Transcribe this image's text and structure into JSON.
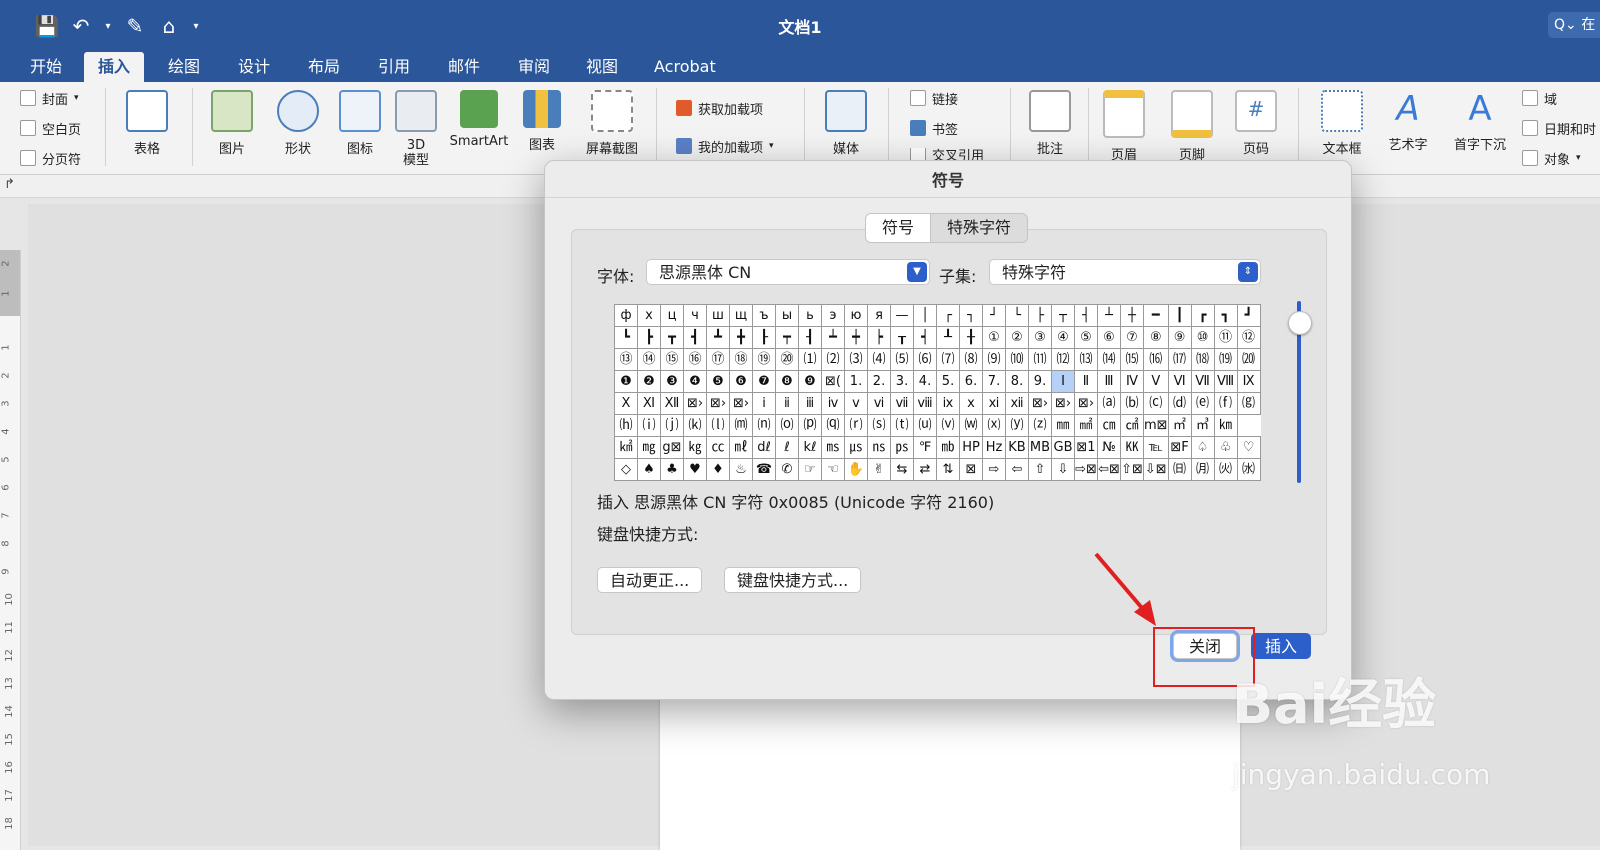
{
  "title_bar": {
    "doc_title": "文档1",
    "search_text": "Q⌄ 在"
  },
  "ribbon_tabs": [
    "开始",
    "插入",
    "绘图",
    "设计",
    "布局",
    "引用",
    "邮件",
    "审阅",
    "视图",
    "Acrobat"
  ],
  "active_tab": "插入",
  "ribbon": {
    "pages": {
      "cover": "封面",
      "blank": "空白页",
      "pagebreak": "分页符"
    },
    "table": "表格",
    "picture": "图片",
    "shapes": "形状",
    "icons": "图标",
    "model3d": "3D\n模型",
    "smartart": "SmartArt",
    "chart": "图表",
    "screenshot": "屏幕截图",
    "get_addins": "获取加载项",
    "my_addins": "我的加载项",
    "media": "媒体",
    "link": "链接",
    "bookmark": "书签",
    "crossref": "交叉引用",
    "comment": "批注",
    "header": "页眉",
    "footer": "页脚",
    "page_number": "页码",
    "textbox": "文本框",
    "wordart": "艺术字",
    "dropcap": "首字下沉",
    "field": "域",
    "datetime": "日期和时",
    "object": "对象"
  },
  "ruler_numbers": [
    "2",
    "1",
    "1",
    "2",
    "3",
    "4",
    "5",
    "6",
    "7",
    "8",
    "9",
    "10",
    "11",
    "12",
    "13",
    "14",
    "15",
    "16",
    "17",
    "18"
  ],
  "dialog": {
    "title": "符号",
    "tabs": [
      "符号",
      "特殊字符"
    ],
    "active_tab": "符号",
    "font_label": "字体:",
    "font_value": "思源黑体 CN",
    "subset_label": "子集:",
    "subset_value": "特殊字符",
    "symbols": [
      [
        "ф",
        "х",
        "ц",
        "ч",
        "ш",
        "щ",
        "ъ",
        "ы",
        "ь",
        "э",
        "ю",
        "я",
        "—",
        "│",
        "┌",
        "┐",
        "┘",
        "└",
        "├",
        "┬",
        "┤",
        "┴",
        "┼",
        "━",
        "┃",
        "┏",
        "┓",
        "┛"
      ],
      [
        "┗",
        "┣",
        "┳",
        "┫",
        "┻",
        "╋",
        "┠",
        "┯",
        "┨",
        "┷",
        "┿",
        "┝",
        "┰",
        "┥",
        "┸",
        "╂",
        "①",
        "②",
        "③",
        "④",
        "⑤",
        "⑥",
        "⑦",
        "⑧",
        "⑨",
        "⑩",
        "⑪",
        "⑫"
      ],
      [
        "⑬",
        "⑭",
        "⑮",
        "⑯",
        "⑰",
        "⑱",
        "⑲",
        "⑳",
        "⑴",
        "⑵",
        "⑶",
        "⑷",
        "⑸",
        "⑹",
        "⑺",
        "⑻",
        "⑼",
        "⑽",
        "⑾",
        "⑿",
        "⒀",
        "⒁",
        "⒂",
        "⒃",
        "⒄",
        "⒅",
        "⒆",
        "⒇"
      ],
      [
        "❶",
        "❷",
        "❸",
        "❹",
        "❺",
        "❻",
        "❼",
        "❽",
        "❾",
        "⊠(",
        "1.",
        "2.",
        "3.",
        "4.",
        "5.",
        "6.",
        "7.",
        "8.",
        "9.",
        "Ⅰ",
        "Ⅱ",
        "Ⅲ",
        "Ⅳ",
        "Ⅴ",
        "Ⅵ",
        "Ⅶ",
        "Ⅷ",
        "Ⅸ"
      ],
      [
        "Ⅹ",
        "Ⅺ",
        "Ⅻ",
        "⊠›",
        "⊠›",
        "⊠›",
        "ⅰ",
        "ⅱ",
        "ⅲ",
        "ⅳ",
        "ⅴ",
        "ⅵ",
        "ⅶ",
        "ⅷ",
        "ⅸ",
        "ⅹ",
        "ⅺ",
        "ⅻ",
        "⊠›",
        "⊠›",
        "⊠›",
        "⒜",
        "⒝",
        "⒞",
        "⒟",
        "⒠",
        "⒡",
        "⒢"
      ],
      [
        "⒣",
        "⒤",
        "⒥",
        "⒦",
        "⒧",
        "⒨",
        "⒩",
        "⒪",
        "⒫",
        "⒬",
        "⒭",
        "⒮",
        "⒯",
        "⒰",
        "⒱",
        "⒲",
        "⒳",
        "⒴",
        "⒵",
        "㎜",
        "㎟",
        "㎝",
        "㎠",
        "m⊠",
        "㎡",
        "㎥",
        "㎞"
      ],
      [
        "㎢",
        "㎎",
        "g⊠",
        "㎏",
        "㏄",
        "㎖",
        "dℓ",
        "ℓ",
        "kℓ",
        "㎳",
        "㎲",
        "㎱",
        "㎰",
        "℉",
        "㏔",
        "HP",
        "Hz",
        "KB",
        "MB",
        "GB",
        "⊠1",
        "№",
        "㏍",
        "℡",
        "⊠F",
        "♤",
        "♧",
        "♡"
      ],
      [
        "◇",
        "♠",
        "♣",
        "♥",
        "♦",
        "♨",
        "☎",
        "✆",
        "☞",
        "☜",
        "✋",
        "✌",
        "⇆",
        "⇄",
        "⇅",
        "⊠",
        "⇨",
        "⇦",
        "⇧",
        "⇩",
        "⇨⊠",
        "⇦⊠",
        "⇧⊠",
        "⇩⊠",
        "㈰",
        "㈪",
        "㈫",
        "㈬"
      ]
    ],
    "selected_symbol": "Ⅰ",
    "insert_info": "插入 思源黑体 CN 字符 0x0085 (Unicode 字符 2160)",
    "shortcut_label": "键盘快捷方式:",
    "autocorrect_button": "自动更正...",
    "shortcut_button": "键盘快捷方式...",
    "close_button": "关闭",
    "insert_button": "插入"
  },
  "watermark": {
    "line1": "Bai经验",
    "line2": "jingyan.baidu.com"
  },
  "colors": {
    "ribbon_blue": "#2b579a",
    "accent": "#2c5fc9",
    "annotation_red": "#e02020"
  }
}
